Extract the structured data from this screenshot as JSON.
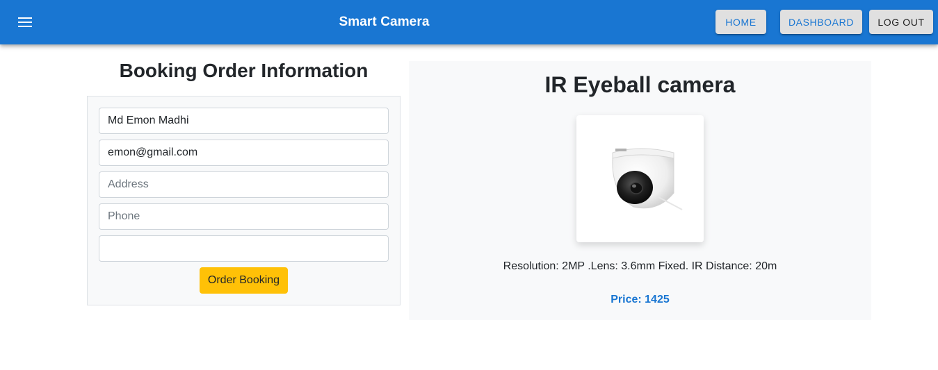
{
  "appbar": {
    "title": "Smart Camera",
    "nav": {
      "home": "HOME",
      "dashboard": "DASHBOARD",
      "logout": "LOG OUT"
    },
    "background": "#1976d2"
  },
  "booking": {
    "heading": "Booking Order Information",
    "name_value": "Md Emon Madhi",
    "email_value": "emon@gmail.com",
    "address_placeholder": "Address",
    "phone_placeholder": "Phone",
    "extra_value": "",
    "submit_label": "Order Booking",
    "submit_color": "#ffc107"
  },
  "product": {
    "name": "IR Eyeball camera",
    "description": "Resolution: 2MP .Lens: 3.6mm Fixed. IR Distance: 20m",
    "price_text": "Price: 1425",
    "price_color": "#1976d2"
  }
}
